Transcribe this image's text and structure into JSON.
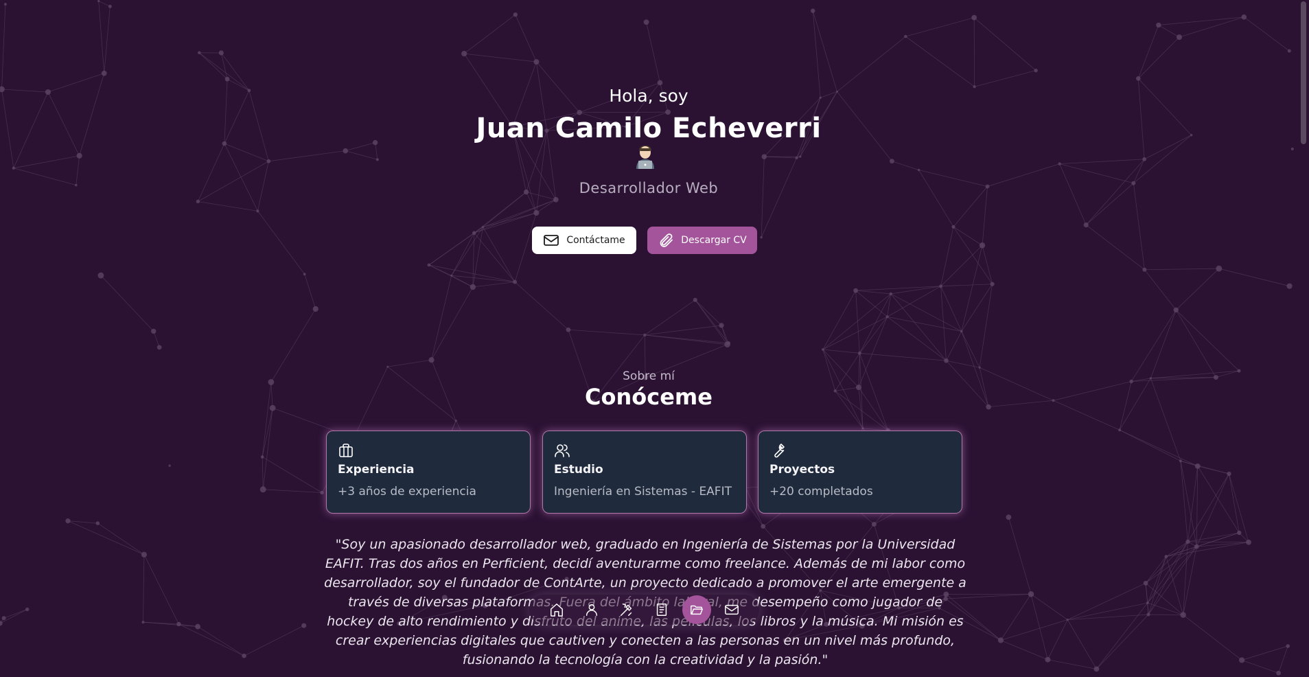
{
  "hero": {
    "greeting": "Hola, soy",
    "name": "Juan Camilo Echeverri",
    "role": "Desarrollador Web",
    "contact_label": "Contáctame",
    "cv_label": "Descargar CV",
    "avatar_icon": "technologist-emoji"
  },
  "about": {
    "eyebrow": "Sobre mí",
    "title": "Conóceme",
    "cards": [
      {
        "icon": "briefcase-icon",
        "title": "Experiencia",
        "value": "+3 años de experiencia"
      },
      {
        "icon": "users-icon",
        "title": "Estudio",
        "value": "Ingeniería en Sistemas - EAFIT"
      },
      {
        "icon": "wrench-icon",
        "title": "Proyectos",
        "value": "+20 completados"
      }
    ],
    "bio": "\"Soy un apasionado desarrollador web, graduado en Ingeniería de Sistemas por la Universidad EAFIT. Tras dos años en Perficient, decidí aventurarme como freelance. Además de mi labor como desarrollador, soy el fundador de ContArte, un proyecto dedicado a promover el arte emergente a través de diversas plataformas. Fuera del ámbito laboral, me desempeño como jugador de hockey de alto rendimiento y disfruto del anime, las películas, los libros y la música. Mi misión es crear experiencias digitales que cautiven y conecten a las personas en un nivel más profundo, fusionando la tecnología con la creatividad y la pasión.\""
  },
  "dock": {
    "items": [
      {
        "icon": "home-icon",
        "active": false
      },
      {
        "icon": "user-icon",
        "active": false
      },
      {
        "icon": "tools-icon",
        "active": false
      },
      {
        "icon": "document-icon",
        "active": false
      },
      {
        "icon": "folder-open-icon",
        "active": true
      },
      {
        "icon": "mail-icon",
        "active": false
      }
    ]
  },
  "colors": {
    "background": "#2b1233",
    "accent": "#a3549b",
    "card_background": "#1f2a3c",
    "card_glow": "#b277ab",
    "network_lines": "#5e4565"
  }
}
